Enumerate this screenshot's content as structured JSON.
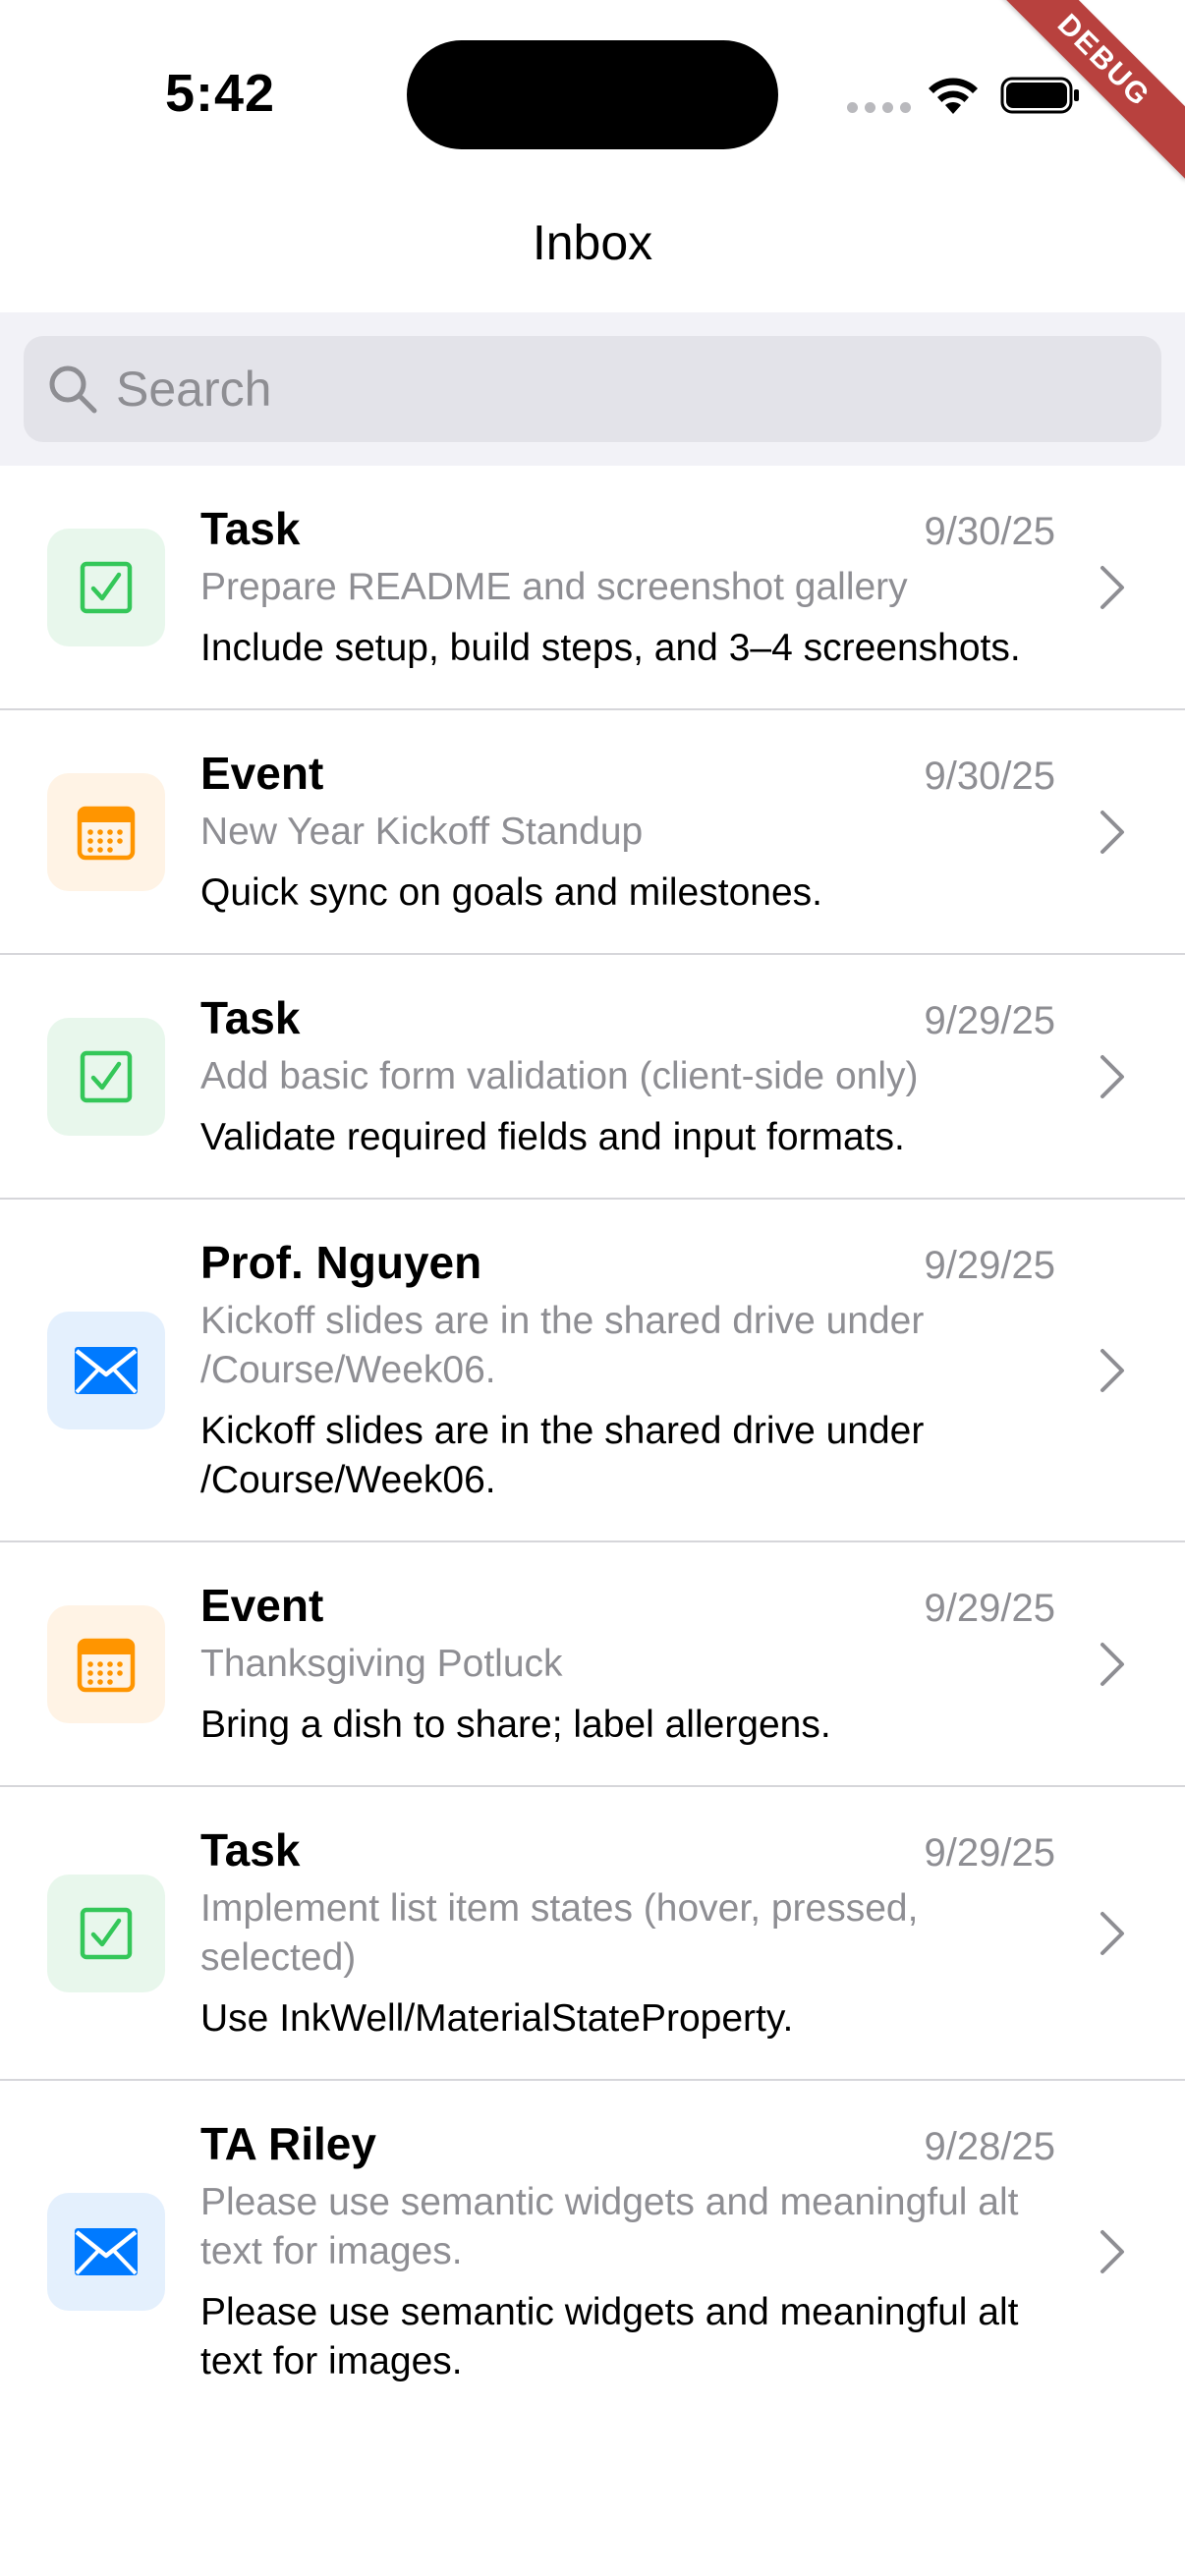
{
  "status_bar": {
    "time": "5:42",
    "debug_label": "DEBUG"
  },
  "nav": {
    "title": "Inbox"
  },
  "search": {
    "placeholder": "Search",
    "value": ""
  },
  "colors": {
    "task_icon": "#34c759",
    "event_icon": "#ff9500",
    "mail_icon": "#007aff",
    "secondary_text": "#8e8e93"
  },
  "items": [
    {
      "kind": "task",
      "icon": "checkbox-icon",
      "title": "Task",
      "date": "9/30/25",
      "subtitle": "Prepare README and screenshot gallery",
      "body": "Include setup, build steps, and 3–4 screenshots."
    },
    {
      "kind": "event",
      "icon": "calendar-icon",
      "title": "Event",
      "date": "9/30/25",
      "subtitle": "New Year Kickoff Standup",
      "body": "Quick sync on goals and milestones."
    },
    {
      "kind": "task",
      "icon": "checkbox-icon",
      "title": "Task",
      "date": "9/29/25",
      "subtitle": "Add basic form validation (client-side only)",
      "body": "Validate required fields and input formats."
    },
    {
      "kind": "mail",
      "icon": "envelope-icon",
      "title": "Prof. Nguyen",
      "date": "9/29/25",
      "subtitle": "Kickoff slides are in the shared drive under /Course/Week06.",
      "body": "Kickoff slides are in the shared drive under /Course/Week06."
    },
    {
      "kind": "event",
      "icon": "calendar-icon",
      "title": "Event",
      "date": "9/29/25",
      "subtitle": "Thanksgiving Potluck",
      "body": "Bring a dish to share; label allergens."
    },
    {
      "kind": "task",
      "icon": "checkbox-icon",
      "title": "Task",
      "date": "9/29/25",
      "subtitle": "Implement list item states (hover, pressed, selected)",
      "body": "Use InkWell/MaterialStateProperty."
    },
    {
      "kind": "mail",
      "icon": "envelope-icon",
      "title": "TA Riley",
      "date": "9/28/25",
      "subtitle": "Please use semantic widgets and meaningful alt text for images.",
      "body": "Please use semantic widgets and meaningful alt text for images."
    }
  ]
}
